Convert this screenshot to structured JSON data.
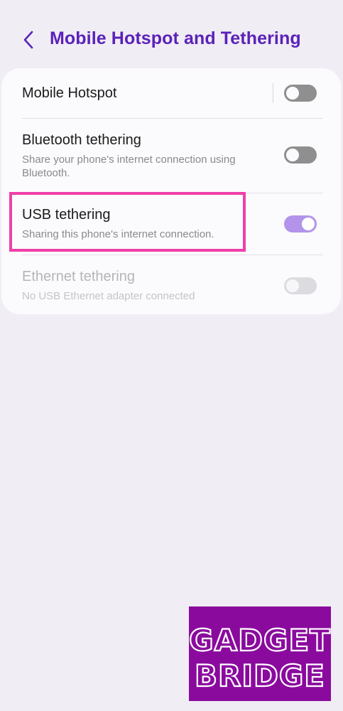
{
  "header": {
    "title": "Mobile Hotspot and Tethering",
    "back_icon": "chevron-left-icon",
    "title_color": "#5b22b8"
  },
  "settings": {
    "mobile_hotspot": {
      "title": "Mobile Hotspot",
      "enabled": false
    },
    "bluetooth_tethering": {
      "title": "Bluetooth tethering",
      "subtitle": "Share your phone's internet connection using Bluetooth.",
      "enabled": false
    },
    "usb_tethering": {
      "title": "USB tethering",
      "subtitle": "Sharing this phone's internet connection.",
      "enabled": true
    },
    "ethernet_tethering": {
      "title": "Ethernet tethering",
      "subtitle": "No USB Ethernet adapter connected",
      "enabled": false,
      "disabled": true
    }
  },
  "colors": {
    "background": "#f0edf5",
    "card": "#fbfafd",
    "toggle_on": "#b394ea",
    "toggle_off": "#8f8f8f",
    "highlight": "#ef3fa8",
    "logo_background": "#8a0a9e"
  },
  "watermark": {
    "line1": "GADGET",
    "line2": "BRIDGE"
  }
}
